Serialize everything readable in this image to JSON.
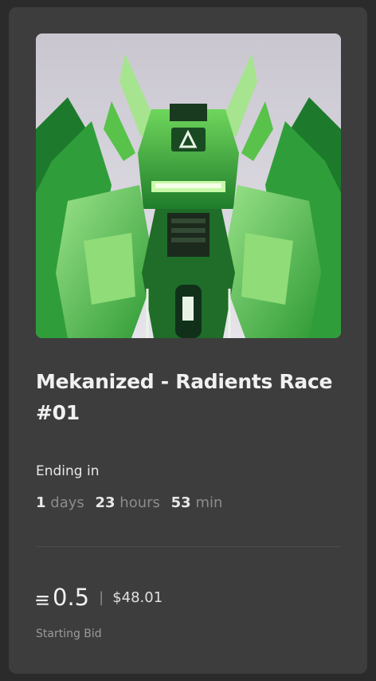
{
  "nft": {
    "title": "Mekanized - Radients Race #01",
    "image_icon": "robot-artwork"
  },
  "auction": {
    "ending_label": "Ending in",
    "countdown": {
      "days": "1",
      "days_unit": "days",
      "hours": "23",
      "hours_unit": "hours",
      "minutes": "53",
      "minutes_unit": "min"
    }
  },
  "price": {
    "currency_icon": "eth-icon",
    "amount": "0.5",
    "separator": "|",
    "usd": "$48.01",
    "label": "Starting Bid"
  },
  "colors": {
    "card_bg": "#3d3d3d",
    "page_bg": "#2b2b2b",
    "accent_green": "#4fd14a"
  }
}
